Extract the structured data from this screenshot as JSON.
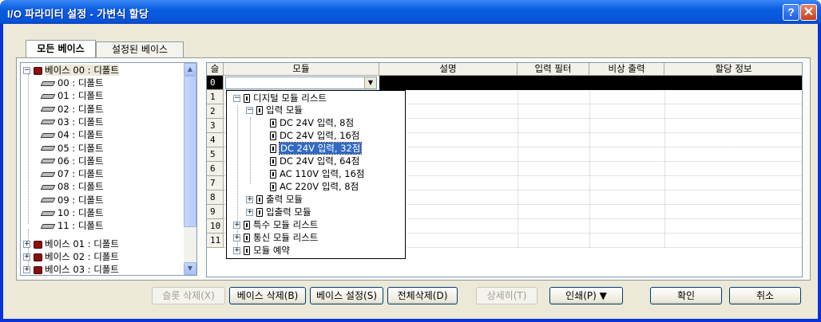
{
  "window": {
    "title": "I/O 파라미터 설정 - 가변식 할당",
    "help_glyph": "?",
    "close_glyph": "✕"
  },
  "tabs": [
    {
      "label": "모든 베이스",
      "active": true
    },
    {
      "label": "설정된 베이스",
      "active": false
    }
  ],
  "tree": {
    "base00": "베이스 00 : 디폴트",
    "slots": [
      "00 : 디폴트",
      "01 : 디폴트",
      "02 : 디폴트",
      "03 : 디폴트",
      "04 : 디폴트",
      "05 : 디폴트",
      "06 : 디폴트",
      "07 : 디폴트",
      "08 : 디폴트",
      "09 : 디폴트",
      "10 : 디폴트",
      "11 : 디폴트"
    ],
    "others": [
      "베이스 01 : 디폴트",
      "베이스 02 : 디폴트",
      "베이스 03 : 디폴트"
    ]
  },
  "grid": {
    "columns": {
      "slot": "슬롯",
      "module": "모듈",
      "desc": "설명",
      "filter": "입력 필터",
      "emergency": "비상 출력",
      "alloc": "할당 정보"
    },
    "rows": [
      "0",
      "1",
      "2",
      "3",
      "4",
      "5",
      "6",
      "7",
      "8",
      "9",
      "10",
      "11"
    ],
    "selected_row": "0"
  },
  "dropdown": {
    "digital": "디지털 모듈 리스트",
    "input": "입력 모듈",
    "input_items": [
      "DC 24V 입력, 8점",
      "DC 24V 입력, 16점",
      "DC 24V 입력, 32점",
      "DC 24V 입력, 64점",
      "AC 110V 입력, 16점",
      "AC 220V 입력, 8점"
    ],
    "selected_item": "DC 24V 입력, 32점",
    "output": "출력 모듈",
    "io": "입출력 모듈",
    "special": "특수 모듈 리스트",
    "comm": "통신 모듈 리스트",
    "reserve": "모듈 예약"
  },
  "buttons": {
    "slot_delete": "슬롯 삭제(X)",
    "base_delete": "베이스 삭제(B)",
    "base_setting": "베이스 설정(S)",
    "delete_all": "전체삭제(D)",
    "details": "상세히(T)",
    "print": "인쇄(P) ▼",
    "ok": "확인",
    "cancel": "취소"
  }
}
